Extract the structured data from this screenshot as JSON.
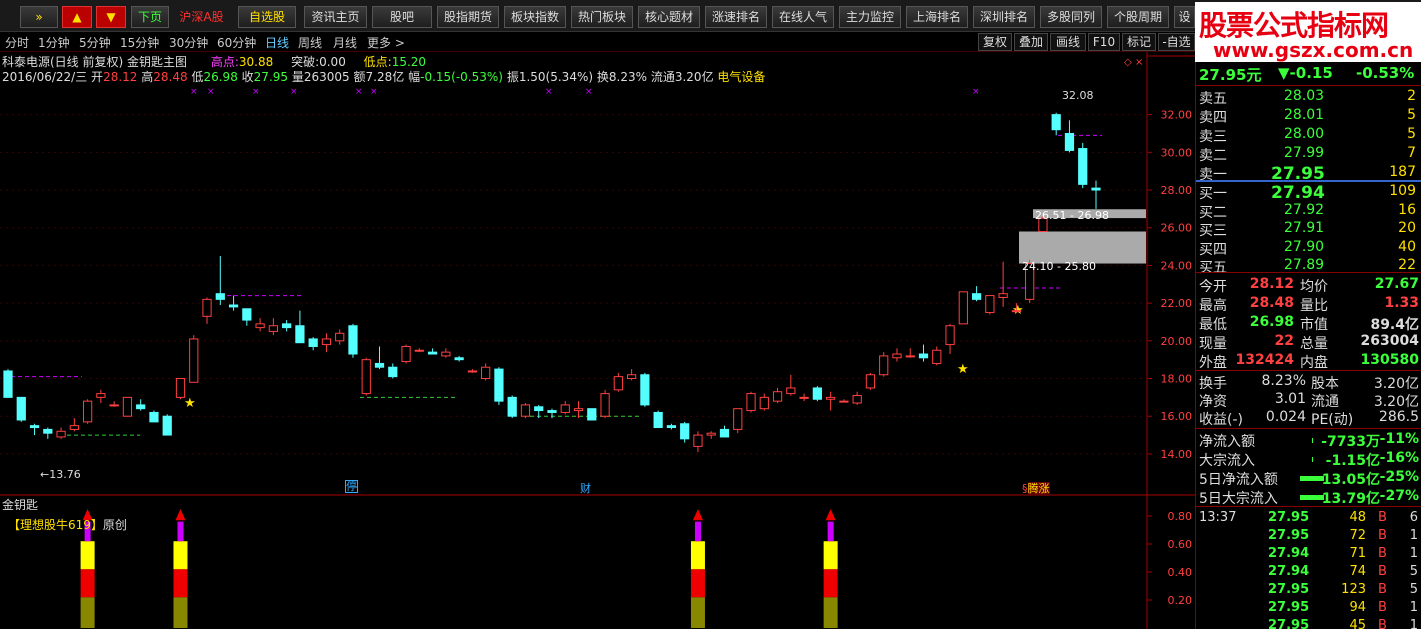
{
  "toolbar": {
    "items": [
      "»",
      "▲",
      "▼",
      "下页",
      "沪深A股",
      "自选股",
      "资讯主页",
      "股吧",
      "股指期货",
      "板块指数",
      "热门板块",
      "核心题材",
      "涨速排名",
      "在线人气",
      "主力监控",
      "上海排名",
      "深圳排名",
      "多股同列",
      "个股周期",
      "设"
    ]
  },
  "periods": [
    "分时",
    "1分钟",
    "5分钟",
    "15分钟",
    "30分钟",
    "60分钟",
    "日线",
    "周线",
    "月线",
    "更多 >"
  ],
  "period_tools": [
    "复权",
    "叠加",
    "画线",
    "F10",
    "标记",
    "-自选"
  ],
  "logo": {
    "title": "股票公式指标网",
    "url": "www.gszx.com.cn"
  },
  "info": {
    "name": "科泰电源(日线 前复权) 金钥匙主图",
    "high_label": "高点:",
    "high": "30.88",
    "break_label": "突破:",
    "break": "0.00",
    "low_label": "低点:",
    "low": "15.20",
    "date": "2016/06/22/三",
    "open_label": "开",
    "open": "28.12",
    "hi_label": "高",
    "hi": "28.48",
    "lo_label": "低",
    "lo": "26.98",
    "close_label": "收",
    "close": "27.95",
    "vol_label": "量",
    "vol": "263005",
    "amt_label": "额",
    "amt": "7.28亿",
    "chg_label": "幅",
    "chg": "-0.15(-0.53%)",
    "amp_label": "振",
    "amp": "1.50(5.34%)",
    "turn_label": "换",
    "turn": "8.23%",
    "float_label": "流通",
    "float": "3.20亿",
    "sector": "电气设备"
  },
  "chart_labels": {
    "high_mark": "32.08",
    "low_mark": "13.76",
    "zone1": "26.51 - 26.98",
    "zone2": "24.10 - 25.80",
    "event1": "停",
    "event2": "财",
    "event3": "腾涨",
    "sub_title": "金钥匙",
    "sub_note_a": "【理想股牛619】",
    "sub_note_b": "原创"
  },
  "chart_data": {
    "type": "candlestick",
    "y_ticks": [
      "32.00",
      "30.00",
      "28.00",
      "26.00",
      "24.00",
      "22.00",
      "20.00",
      "18.00",
      "16.00",
      "14.00"
    ],
    "ylim": [
      13.2,
      33.2
    ],
    "sub_y_ticks": [
      "0.80",
      "0.60",
      "0.40",
      "0.20"
    ],
    "sub_ylim": [
      0,
      0.9
    ],
    "candles": [
      [
        18.4,
        18.5,
        17.0,
        17.0
      ],
      [
        17.0,
        17.0,
        15.7,
        15.8
      ],
      [
        15.5,
        15.6,
        15.0,
        15.4
      ],
      [
        15.3,
        15.4,
        14.8,
        15.1
      ],
      [
        14.9,
        15.4,
        14.8,
        15.2
      ],
      [
        15.3,
        15.9,
        15.2,
        15.5
      ],
      [
        15.7,
        16.9,
        15.6,
        16.8
      ],
      [
        17.0,
        17.4,
        16.7,
        17.2
      ],
      [
        16.6,
        16.8,
        16.5,
        16.6
      ],
      [
        16.0,
        17.0,
        16.0,
        17.0
      ],
      [
        16.6,
        16.9,
        16.3,
        16.4
      ],
      [
        16.2,
        16.3,
        15.7,
        15.7
      ],
      [
        16.0,
        16.1,
        15.0,
        15.0
      ],
      [
        17.0,
        18.0,
        16.9,
        18.0
      ],
      [
        17.8,
        20.3,
        17.8,
        20.1
      ],
      [
        21.3,
        22.3,
        20.9,
        22.2
      ],
      [
        22.5,
        24.5,
        21.9,
        22.2
      ],
      [
        21.9,
        22.4,
        21.6,
        21.8
      ],
      [
        21.7,
        21.7,
        20.8,
        21.1
      ],
      [
        20.7,
        21.2,
        20.5,
        20.9
      ],
      [
        20.5,
        21.2,
        20.3,
        20.8
      ],
      [
        20.9,
        21.1,
        20.5,
        20.7
      ],
      [
        20.8,
        21.6,
        19.9,
        19.9
      ],
      [
        20.1,
        20.2,
        19.5,
        19.7
      ],
      [
        19.8,
        20.4,
        19.4,
        20.1
      ],
      [
        20.0,
        20.6,
        19.8,
        20.4
      ],
      [
        20.8,
        20.9,
        19.1,
        19.3
      ],
      [
        17.2,
        19.1,
        17.1,
        19.0
      ],
      [
        18.8,
        19.7,
        18.5,
        18.6
      ],
      [
        18.6,
        18.8,
        18.0,
        18.1
      ],
      [
        18.9,
        19.8,
        18.8,
        19.7
      ],
      [
        19.5,
        19.6,
        19.4,
        19.5
      ],
      [
        19.4,
        19.6,
        19.3,
        19.3
      ],
      [
        19.2,
        19.6,
        19.1,
        19.4
      ],
      [
        19.1,
        19.2,
        18.9,
        19.0
      ],
      [
        18.4,
        18.5,
        18.3,
        18.4
      ],
      [
        18.0,
        18.8,
        17.9,
        18.6
      ],
      [
        18.5,
        18.6,
        16.6,
        16.8
      ],
      [
        17.0,
        17.1,
        15.9,
        16.0
      ],
      [
        16.0,
        16.7,
        15.9,
        16.6
      ],
      [
        16.5,
        16.6,
        15.9,
        16.3
      ],
      [
        16.3,
        16.4,
        15.9,
        16.2
      ],
      [
        16.2,
        16.8,
        16.1,
        16.6
      ],
      [
        16.3,
        16.8,
        15.9,
        16.4
      ],
      [
        16.4,
        16.4,
        15.8,
        15.8
      ],
      [
        16.0,
        17.4,
        15.9,
        17.2
      ],
      [
        17.4,
        18.3,
        17.3,
        18.1
      ],
      [
        18.0,
        18.5,
        17.9,
        18.2
      ],
      [
        18.2,
        18.3,
        16.5,
        16.6
      ],
      [
        16.2,
        16.3,
        15.4,
        15.4
      ],
      [
        15.5,
        15.6,
        15.3,
        15.4
      ],
      [
        15.6,
        15.7,
        14.6,
        14.8
      ],
      [
        14.4,
        15.2,
        14.1,
        15.0
      ],
      [
        15.0,
        15.2,
        14.8,
        15.1
      ],
      [
        15.3,
        15.5,
        14.9,
        14.9
      ],
      [
        15.3,
        16.4,
        15.1,
        16.4
      ],
      [
        16.3,
        17.3,
        16.2,
        17.2
      ],
      [
        16.4,
        17.2,
        16.3,
        17.0
      ],
      [
        16.8,
        17.5,
        16.7,
        17.3
      ],
      [
        17.2,
        18.2,
        17.1,
        17.5
      ],
      [
        17.0,
        17.2,
        16.8,
        17.0
      ],
      [
        17.5,
        17.6,
        16.8,
        16.9
      ],
      [
        16.9,
        17.3,
        16.3,
        17.0
      ],
      [
        16.8,
        16.9,
        16.8,
        16.8
      ],
      [
        16.7,
        17.3,
        16.6,
        17.1
      ],
      [
        17.5,
        18.3,
        17.4,
        18.2
      ],
      [
        18.2,
        19.4,
        18.1,
        19.2
      ],
      [
        19.1,
        19.6,
        18.9,
        19.3
      ],
      [
        19.2,
        19.6,
        19.1,
        19.2
      ],
      [
        19.3,
        19.8,
        18.9,
        19.1
      ],
      [
        18.8,
        19.7,
        18.7,
        19.5
      ],
      [
        19.8,
        20.9,
        19.3,
        20.8
      ],
      [
        20.9,
        22.6,
        20.9,
        22.6
      ],
      [
        22.5,
        22.9,
        22.1,
        22.2
      ],
      [
        21.5,
        22.4,
        21.4,
        22.4
      ],
      [
        22.3,
        24.2,
        21.8,
        22.5
      ],
      [
        21.6,
        22.0,
        21.5,
        21.6
      ],
      [
        22.2,
        24.3,
        22.0,
        24.1
      ],
      [
        25.8,
        26.6,
        25.8,
        26.5
      ],
      [
        32.0,
        32.1,
        30.9,
        31.2
      ],
      [
        31.0,
        31.7,
        30.0,
        30.1
      ],
      [
        30.2,
        30.5,
        28.1,
        28.3
      ],
      [
        28.1,
        28.5,
        27.0,
        28.0
      ]
    ],
    "indicator_signals": [
      6,
      13,
      52,
      62
    ]
  },
  "quote": {
    "price": "27.95元",
    "change": "▼-0.15",
    "pct": "-0.53%",
    "asks": [
      {
        "label": "卖五",
        "price": "28.03",
        "vol": "2"
      },
      {
        "label": "卖四",
        "price": "28.01",
        "vol": "5"
      },
      {
        "label": "卖三",
        "price": "28.00",
        "vol": "5"
      },
      {
        "label": "卖二",
        "price": "27.99",
        "vol": "7"
      },
      {
        "label": "卖一",
        "price": "27.95",
        "vol": "187"
      }
    ],
    "bids": [
      {
        "label": "买一",
        "price": "27.94",
        "vol": "109"
      },
      {
        "label": "买二",
        "price": "27.92",
        "vol": "16"
      },
      {
        "label": "买三",
        "price": "27.91",
        "vol": "20"
      },
      {
        "label": "买四",
        "price": "27.90",
        "vol": "40"
      },
      {
        "label": "买五",
        "price": "27.89",
        "vol": "22"
      }
    ],
    "stats": [
      {
        "l1": "今开",
        "v1": "28.12",
        "c1": "red",
        "l2": "均价",
        "v2": "27.67",
        "c2": "grn"
      },
      {
        "l1": "最高",
        "v1": "28.48",
        "c1": "red",
        "l2": "量比",
        "v2": "1.33",
        "c2": "red"
      },
      {
        "l1": "最低",
        "v1": "26.98",
        "c1": "grn",
        "l2": "市值",
        "v2": "89.4亿",
        "c2": "white"
      },
      {
        "l1": "现量",
        "v1": "22",
        "c1": "red",
        "l2": "总量",
        "v2": "263004",
        "c2": "white"
      },
      {
        "l1": "外盘",
        "v1": "132424",
        "c1": "red",
        "l2": "内盘",
        "v2": "130580",
        "c2": "grn"
      }
    ],
    "stats2": [
      {
        "l1": "换手",
        "v1": "8.23%",
        "l2": "股本",
        "v2": "3.20亿"
      },
      {
        "l1": "净资",
        "v1": "3.01",
        "l2": "流通",
        "v2": "3.20亿"
      },
      {
        "l1": "收益(-)",
        "v1": "0.024",
        "l2": "PE(动)",
        "v2": "286.5"
      }
    ],
    "flows": [
      {
        "label": "净流入额",
        "val": "-7733万",
        "pct": "-11%",
        "bar": 0.0
      },
      {
        "label": "大宗流入",
        "val": "-1.15亿",
        "pct": "-16%",
        "bar": 0.0
      },
      {
        "label": "5日净流入额",
        "val": "-13.05亿",
        "pct": "-25%",
        "bar": 0.6
      },
      {
        "label": "5日大宗流入",
        "val": "-13.79亿",
        "pct": "-27%",
        "bar": 0.6
      }
    ],
    "ticks": [
      {
        "time": "13:37",
        "price": "27.95",
        "vol": "48",
        "bs": "B",
        "n": "6"
      },
      {
        "time": "",
        "price": "27.95",
        "vol": "72",
        "bs": "B",
        "n": "1"
      },
      {
        "time": "",
        "price": "27.94",
        "vol": "71",
        "bs": "B",
        "n": "1"
      },
      {
        "time": "",
        "price": "27.94",
        "vol": "74",
        "bs": "B",
        "n": "5"
      },
      {
        "time": "",
        "price": "27.95",
        "vol": "123",
        "bs": "B",
        "n": "5"
      },
      {
        "time": "",
        "price": "27.95",
        "vol": "94",
        "bs": "B",
        "n": "1"
      },
      {
        "time": "",
        "price": "27.95",
        "vol": "45",
        "bs": "B",
        "n": "1"
      }
    ]
  }
}
